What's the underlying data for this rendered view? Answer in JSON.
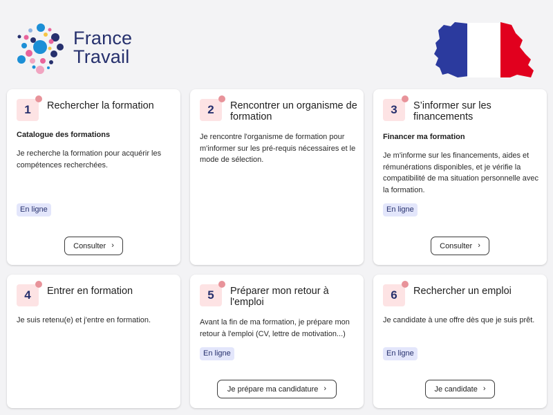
{
  "brand": {
    "line1": "France",
    "line2": "Travail"
  },
  "steps": [
    {
      "number": "1",
      "title": "Rechercher la formation",
      "subtitle": "Catalogue des formations",
      "description": "Je recherche la formation pour acquérir les compétences recherchées.",
      "tag": "En ligne",
      "button": "Consulter"
    },
    {
      "number": "2",
      "title": "Rencontrer un organisme de formation",
      "description": "Je rencontre l'organisme de formation pour m'informer sur les pré-requis nécessaires et le mode de sélection."
    },
    {
      "number": "3",
      "title": "S’informer sur les financements",
      "subtitle": "Financer ma formation",
      "description": "Je m'informe sur les financements, aides et rémunérations disponibles, et je vérifie la compatibilité de ma situation personnelle avec la formation.",
      "tag": "En ligne",
      "button": "Consulter"
    },
    {
      "number": "4",
      "title": "Entrer en formation",
      "description": "Je suis retenu(e) et j'entre en formation."
    },
    {
      "number": "5",
      "title": "Préparer mon retour à l'emploi",
      "description": "Avant la fin de ma formation, je prépare mon retour à l'emploi (CV, lettre de motivation...)",
      "tag": "En ligne",
      "button": "Je prépare ma candidature"
    },
    {
      "number": "6",
      "title": "Rechercher un emploi",
      "description": "Je candidate à une offre dès que je suis prêt.",
      "tag": "En ligne",
      "button": "Je candidate"
    }
  ],
  "icons": {
    "button_chevron": "chevron-right-icon"
  },
  "colors": {
    "brand_navy": "#26306d",
    "badge_bg": "#fde3e4",
    "tag_bg": "#e3e6fb",
    "flag_blue": "#2b3a9e",
    "flag_red": "#e1001e"
  }
}
